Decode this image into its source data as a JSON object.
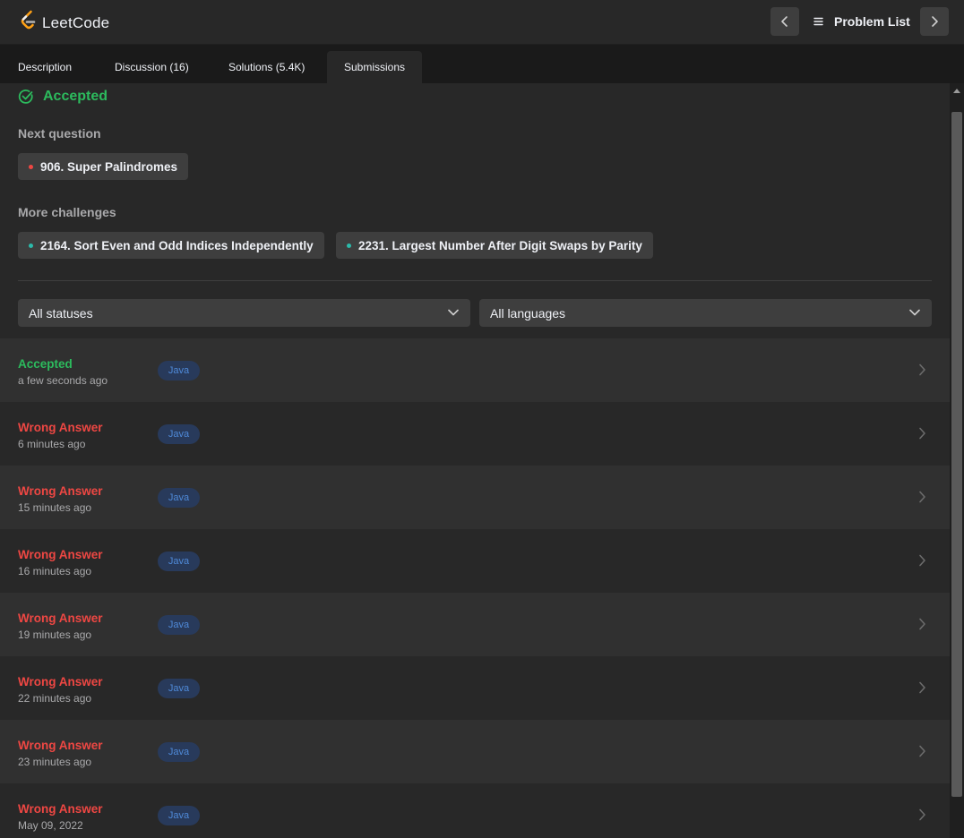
{
  "app": {
    "name": "LeetCode"
  },
  "header": {
    "problem_list_label": "Problem List"
  },
  "tabs": [
    {
      "label": "Description"
    },
    {
      "label": "Discussion (16)"
    },
    {
      "label": "Solutions (5.4K)"
    },
    {
      "label": "Submissions",
      "active": true
    }
  ],
  "result": {
    "status": "Accepted"
  },
  "next_question": {
    "label": "Next question",
    "item": {
      "title": "906. Super Palindromes",
      "difficulty_color": "#ef4743"
    }
  },
  "more_challenges": {
    "label": "More challenges",
    "items": [
      {
        "title": "2164. Sort Even and Odd Indices Independently",
        "difficulty_color": "#2cbbab"
      },
      {
        "title": "2231. Largest Number After Digit Swaps by Parity",
        "difficulty_color": "#2cbbab"
      }
    ]
  },
  "filters": {
    "status": "All statuses",
    "language": "All languages"
  },
  "submissions": [
    {
      "status": "Accepted",
      "time": "a few seconds ago",
      "language": "Java"
    },
    {
      "status": "Wrong Answer",
      "time": "6 minutes ago",
      "language": "Java"
    },
    {
      "status": "Wrong Answer",
      "time": "15 minutes ago",
      "language": "Java"
    },
    {
      "status": "Wrong Answer",
      "time": "16 minutes ago",
      "language": "Java"
    },
    {
      "status": "Wrong Answer",
      "time": "19 minutes ago",
      "language": "Java"
    },
    {
      "status": "Wrong Answer",
      "time": "22 minutes ago",
      "language": "Java"
    },
    {
      "status": "Wrong Answer",
      "time": "23 minutes ago",
      "language": "Java"
    },
    {
      "status": "Wrong Answer",
      "time": "May 09, 2022",
      "language": "Java"
    }
  ],
  "colors": {
    "accepted": "#2cbb5d",
    "wrong": "#ef4743",
    "badge_text": "#4f8ad9"
  }
}
